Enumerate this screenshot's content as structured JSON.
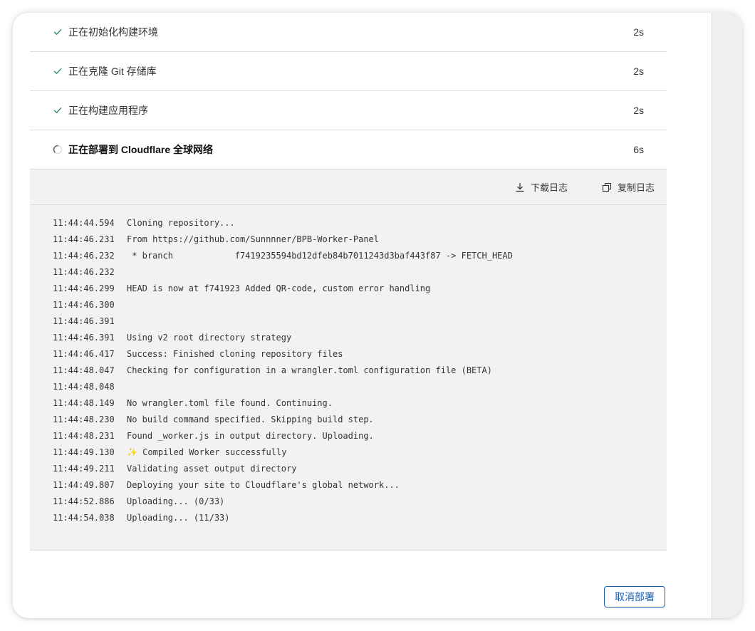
{
  "steps": [
    {
      "label": "正在初始化构建环境",
      "duration": "2s",
      "state": "done"
    },
    {
      "label": "正在克隆 Git 存储库",
      "duration": "2s",
      "state": "done"
    },
    {
      "label": "正在构建应用程序",
      "duration": "2s",
      "state": "done"
    },
    {
      "label": "正在部署到 Cloudflare 全球网络",
      "duration": "6s",
      "state": "in-progress"
    }
  ],
  "log_toolbar": {
    "download_label": "下载日志",
    "copy_label": "复制日志"
  },
  "log_lines": [
    {
      "ts": "11:44:44.594",
      "msg": "Cloning repository..."
    },
    {
      "ts": "11:44:46.231",
      "msg": "From https://github.com/Sunnnner/BPB-Worker-Panel"
    },
    {
      "ts": "11:44:46.232",
      "msg": " * branch            f7419235594bd12dfeb84b7011243d3baf443f87 -> FETCH_HEAD"
    },
    {
      "ts": "11:44:46.232",
      "msg": ""
    },
    {
      "ts": "11:44:46.299",
      "msg": "HEAD is now at f741923 Added QR-code, custom error handling"
    },
    {
      "ts": "11:44:46.300",
      "msg": ""
    },
    {
      "ts": "11:44:46.391",
      "msg": ""
    },
    {
      "ts": "11:44:46.391",
      "msg": "Using v2 root directory strategy"
    },
    {
      "ts": "11:44:46.417",
      "msg": "Success: Finished cloning repository files"
    },
    {
      "ts": "11:44:48.047",
      "msg": "Checking for configuration in a wrangler.toml configuration file (BETA)"
    },
    {
      "ts": "11:44:48.048",
      "msg": ""
    },
    {
      "ts": "11:44:48.149",
      "msg": "No wrangler.toml file found. Continuing."
    },
    {
      "ts": "11:44:48.230",
      "msg": "No build command specified. Skipping build step."
    },
    {
      "ts": "11:44:48.231",
      "msg": "Found _worker.js in output directory. Uploading."
    },
    {
      "ts": "11:44:49.130",
      "msg": "✨ Compiled Worker successfully"
    },
    {
      "ts": "11:44:49.211",
      "msg": "Validating asset output directory"
    },
    {
      "ts": "11:44:49.807",
      "msg": "Deploying your site to Cloudflare's global network..."
    },
    {
      "ts": "11:44:52.886",
      "msg": "Uploading... (0/33)"
    },
    {
      "ts": "11:44:54.038",
      "msg": "Uploading... (11/33)"
    }
  ],
  "cancel_label": "取消部署",
  "colors": {
    "check": "#2e8b57",
    "accent": "#1a5fb4",
    "log_bg": "#f2f2f2"
  },
  "icons": {
    "done": "check-icon",
    "in_progress": "spinner-icon",
    "download": "download-icon",
    "copy": "copy-icon"
  }
}
